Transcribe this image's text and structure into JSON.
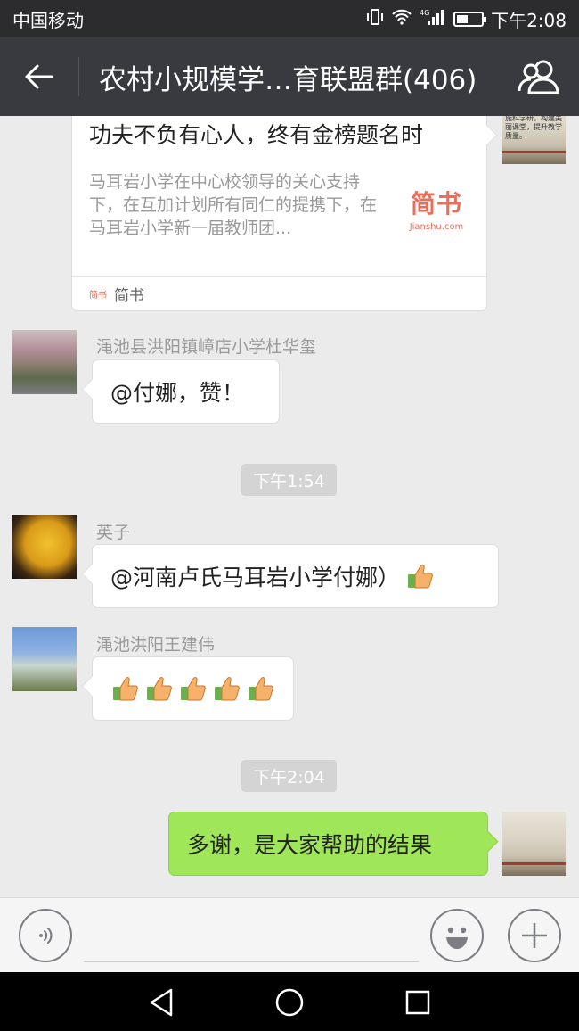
{
  "status_bar": {
    "carrier": "中国移动",
    "network": "4G",
    "time": "下午2:08"
  },
  "header": {
    "title": "农村小规模学…育联盟群(406)"
  },
  "link_card": {
    "title": "功夫不负有心人，终有金榜题名时",
    "description": "马耳岩小学在中心校领导的关心支持下，在互加计划所有同仁的提携下，在马耳岩小学新一届教师团...",
    "logo_text": "简书",
    "logo_sub": "Jianshu.com",
    "source_icon_text": "简书",
    "source": "简书"
  },
  "avatar_text": "加强执法建设，实施科学研，构建美丽课堂，提升教学质量。",
  "messages": [
    {
      "sender": "渑池县洪阳镇嶂店小学杜华玺",
      "text": "@付娜，赞！"
    },
    {
      "time": "下午1:54"
    },
    {
      "sender": "英子",
      "text": "@河南卢氏马耳岩小学付娜）"
    },
    {
      "sender": "渑池洪阳王建伟",
      "thumbs_count": 5
    },
    {
      "time": "下午2:04"
    },
    {
      "sender": "me",
      "text": "多谢，是大家帮助的结果"
    }
  ],
  "colors": {
    "header_bg": "#393a3f",
    "sent_bubble": "#9fe658",
    "chat_bg": "#ebebeb",
    "jianshu_red": "#ea6f5a"
  }
}
